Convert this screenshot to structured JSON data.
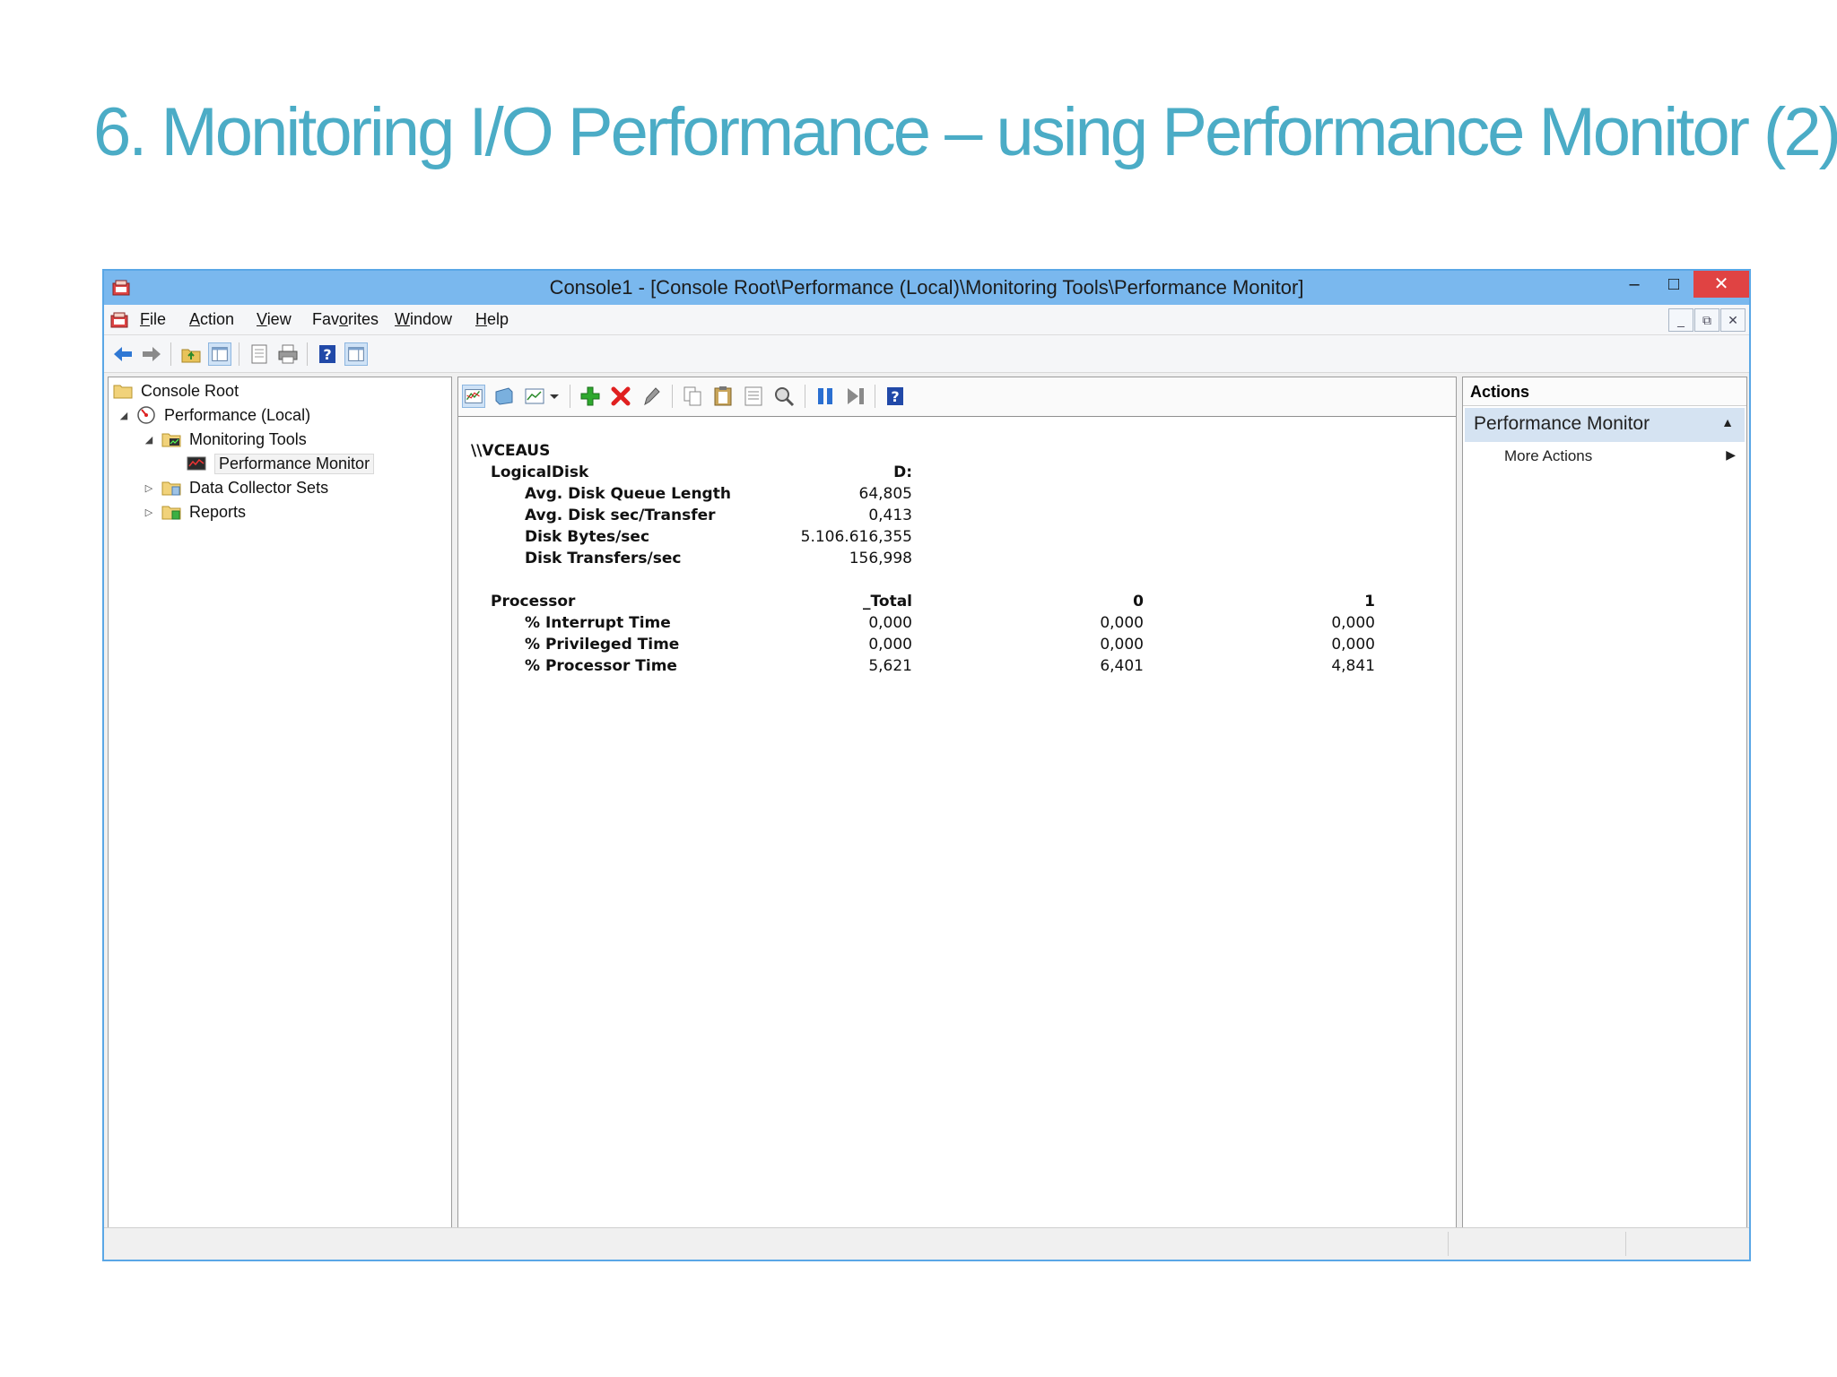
{
  "slide": {
    "title": "6. Monitoring I/O Performance – using Performance Monitor (2)"
  },
  "window": {
    "title": "Console1 - [Console Root\\Performance (Local)\\Monitoring Tools\\Performance Monitor]",
    "controls": {
      "minimize": "–",
      "maximize": "□",
      "close": "✕"
    }
  },
  "menubar": {
    "items": [
      {
        "label": "File",
        "mnemonic": "F"
      },
      {
        "label": "Action",
        "mnemonic": "A"
      },
      {
        "label": "View",
        "mnemonic": "V"
      },
      {
        "label": "Favorites",
        "mnemonic": "o"
      },
      {
        "label": "Window",
        "mnemonic": "W"
      },
      {
        "label": "Help",
        "mnemonic": "H"
      }
    ],
    "mdi": {
      "minimize": "_",
      "restore": "⧉",
      "close": "✕"
    }
  },
  "toolbar": {
    "icons": [
      "back-arrow-icon",
      "forward-arrow-icon",
      "up-folder-icon",
      "show-hide-tree-icon",
      "export-list-icon",
      "print-icon",
      "help-icon",
      "show-action-pane-icon"
    ]
  },
  "tree": {
    "items": [
      {
        "label": "Console Root",
        "icon": "folder-icon",
        "expander": ""
      },
      {
        "label": "Performance (Local)",
        "icon": "performance-icon",
        "expander": "◢"
      },
      {
        "label": "Monitoring Tools",
        "icon": "monitoring-folder-icon",
        "expander": "◢"
      },
      {
        "label": "Performance Monitor",
        "icon": "performance-monitor-icon",
        "expander": ""
      },
      {
        "label": "Data Collector Sets",
        "icon": "data-collector-icon",
        "expander": "▷"
      },
      {
        "label": "Reports",
        "icon": "reports-icon",
        "expander": "▷"
      }
    ]
  },
  "perfmon_toolbar": {
    "icons": [
      "view-graph-icon",
      "freeze-display-icon",
      "change-graph-type-icon",
      "dropdown-arrow-icon",
      "add-counter-icon",
      "delete-counter-icon",
      "highlight-icon",
      "copy-properties-icon",
      "paste-counter-list-icon",
      "properties-icon",
      "zoom-icon",
      "pause-icon",
      "update-data-icon",
      "help-icon"
    ],
    "colors": {
      "add": "#2ea82e",
      "delete": "#e02020",
      "pause": "#2a6fd1",
      "help": "#1e4fb0"
    }
  },
  "report": {
    "computer": "\\\\VCEAUS",
    "logical_disk": {
      "object": "LogicalDisk",
      "instance": "D:",
      "counters": [
        {
          "name": "Avg. Disk Queue Length",
          "value": "64,805"
        },
        {
          "name": "Avg. Disk sec/Transfer",
          "value": "0,413"
        },
        {
          "name": "Disk Bytes/sec",
          "value": "5.106.616,355"
        },
        {
          "name": "Disk Transfers/sec",
          "value": "156,998"
        }
      ]
    },
    "processor": {
      "object": "Processor",
      "instances": [
        "_Total",
        "0",
        "1"
      ],
      "counters": [
        {
          "name": "% Interrupt Time",
          "values": [
            "0,000",
            "0,000",
            "0,000"
          ]
        },
        {
          "name": "% Privileged Time",
          "values": [
            "0,000",
            "0,000",
            "0,000"
          ]
        },
        {
          "name": "% Processor Time",
          "values": [
            "5,621",
            "6,401",
            "4,841"
          ]
        }
      ]
    }
  },
  "actions": {
    "header": "Actions",
    "section": "Performance Monitor",
    "items": [
      "More Actions"
    ]
  }
}
